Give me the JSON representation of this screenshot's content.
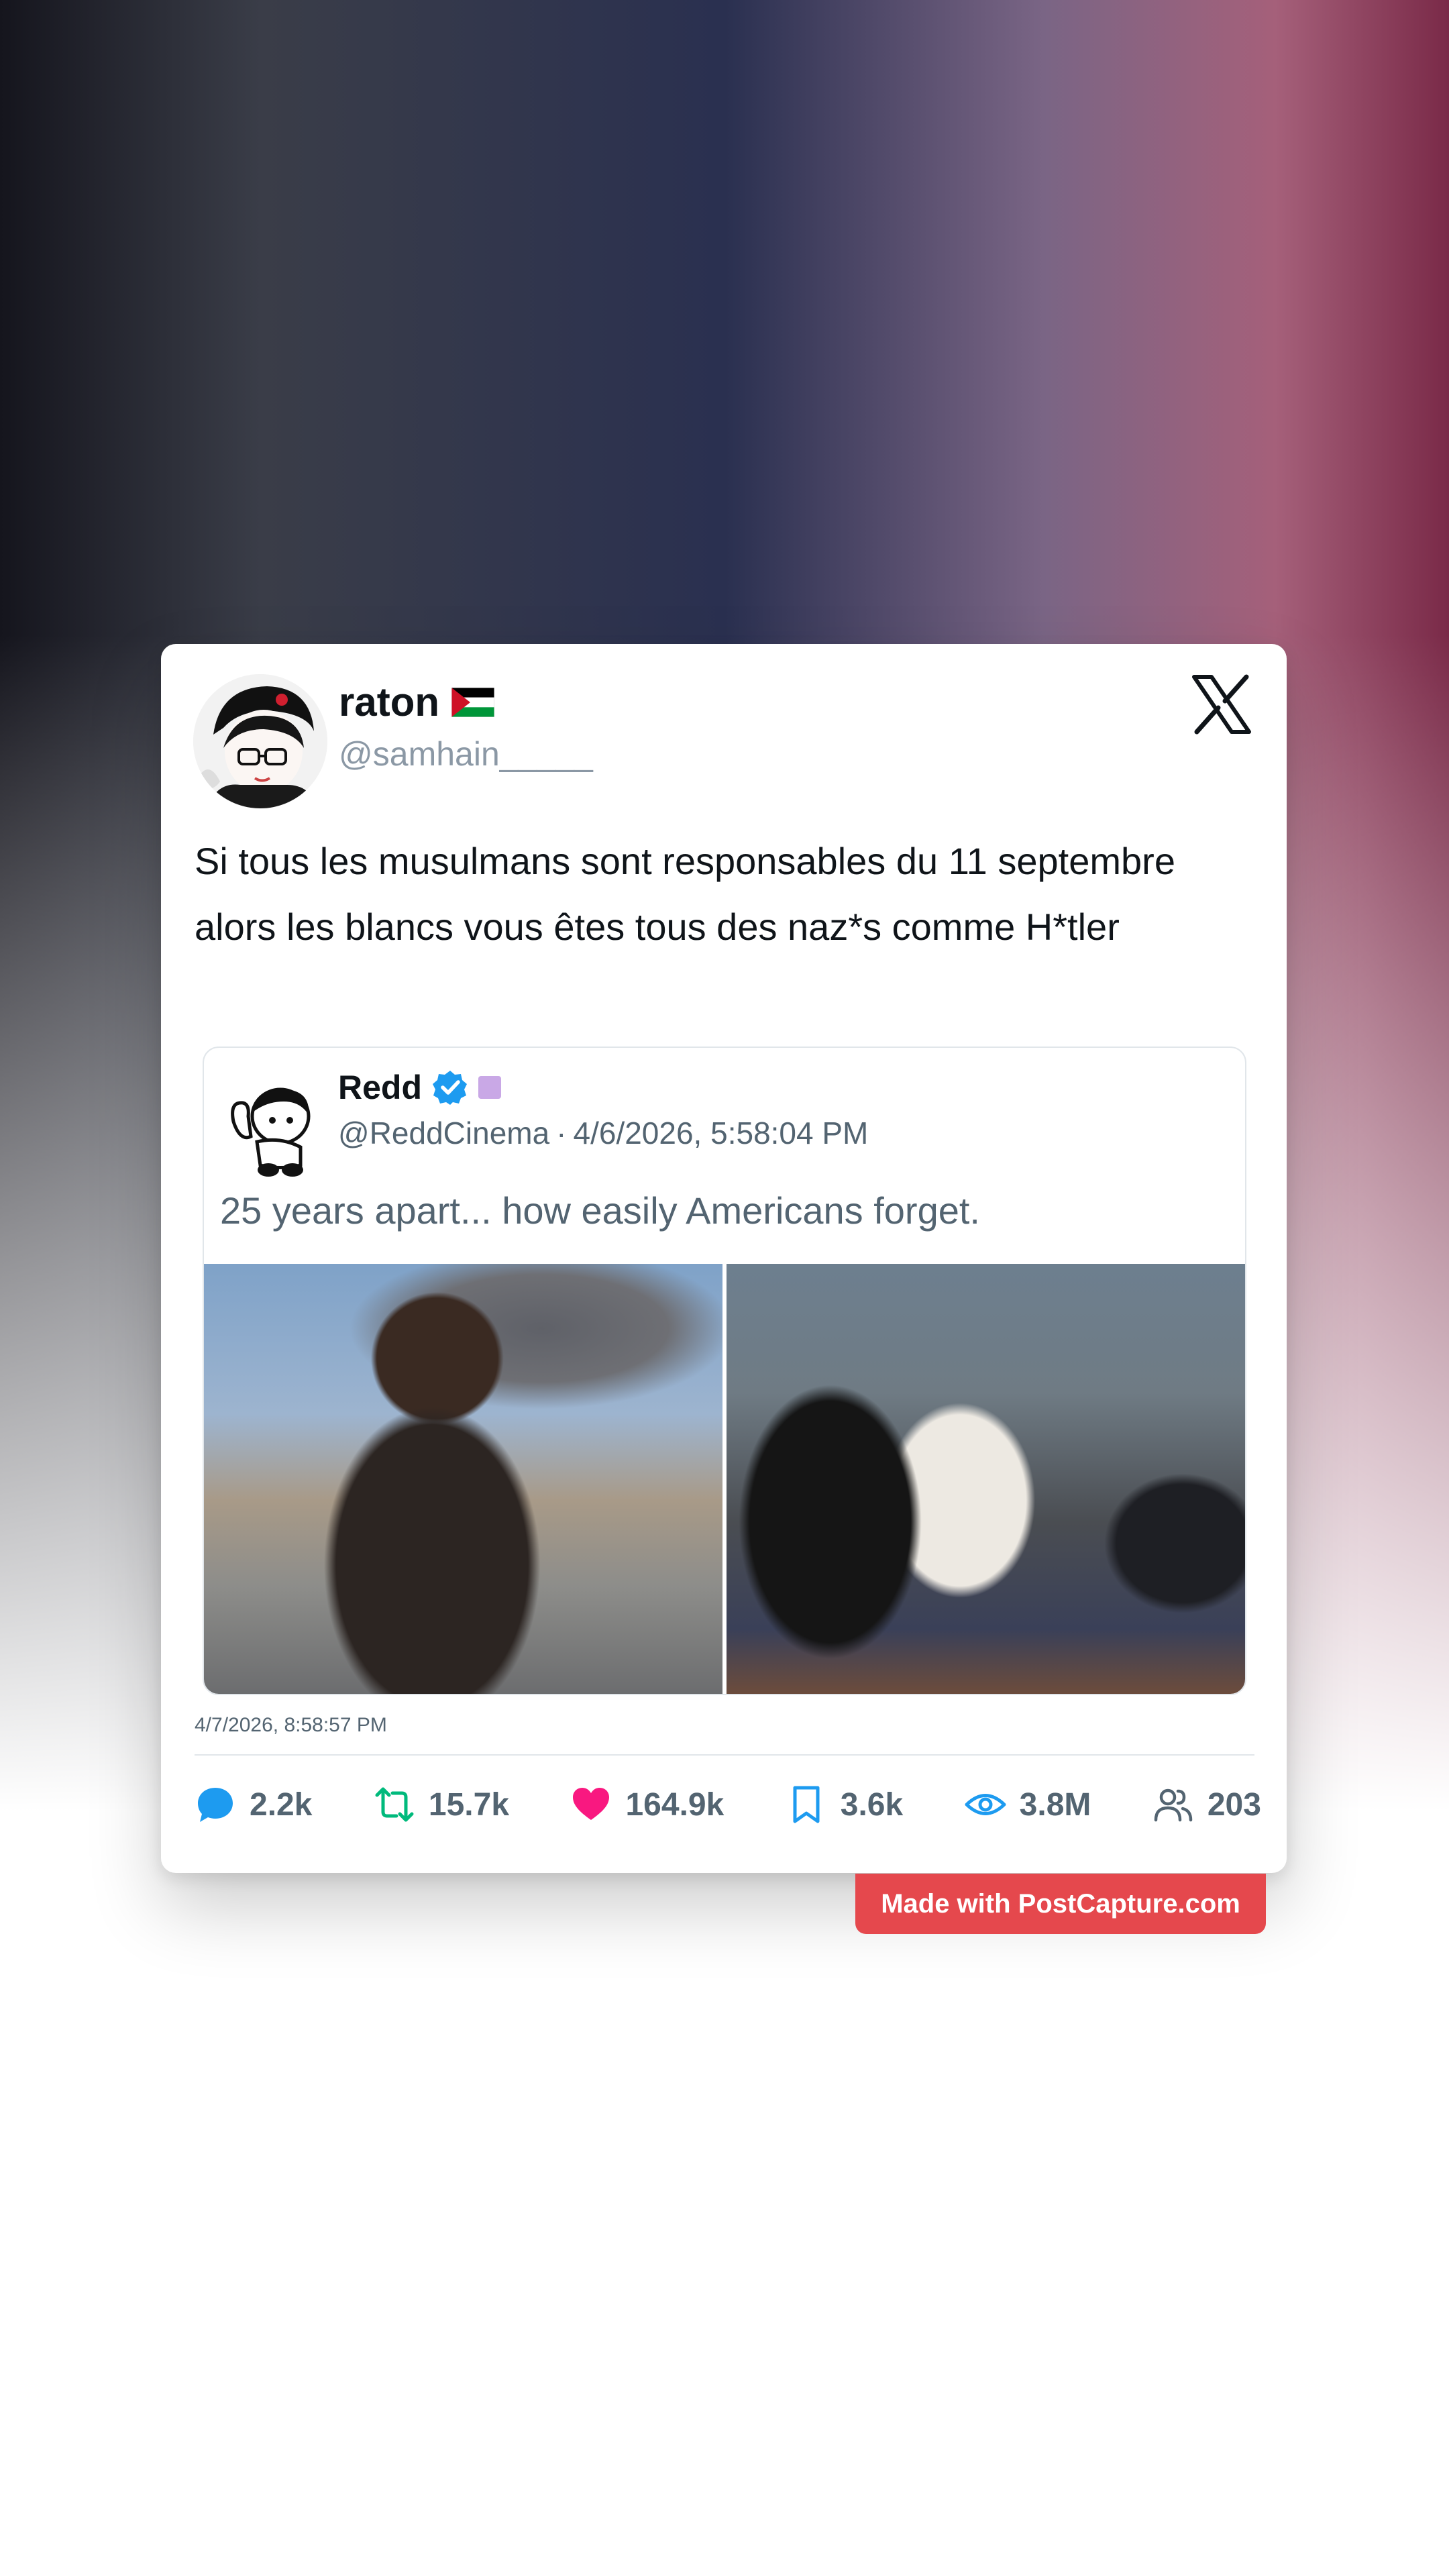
{
  "colors": {
    "brand_red": "#e5484d",
    "reply_blue": "#1d9bf0",
    "repost_green": "#00ba7c",
    "like_pink": "#f91880",
    "text_muted": "#536471"
  },
  "tweet": {
    "display_name": "raton",
    "flag_icon": "palestine-flag-icon",
    "handle": "@samhain_____",
    "platform_icon": "x-logo-icon",
    "text": "Si tous les musulmans sont responsables du 11 septembre alors les blancs vous êtes tous des naz*s comme H*tler",
    "timestamp": "4/7/2026, 8:58:57 PM"
  },
  "quoted": {
    "display_name": "Redd",
    "verified_icon": "verified-badge-icon",
    "handle": "@ReddCinema",
    "separator": "·",
    "datetime": "4/6/2026, 5:58:04 PM",
    "text": "25 years apart... how easily Americans forget.",
    "media": [
      {
        "name": "crying-woman-photo"
      },
      {
        "name": "group-sitting-photo"
      }
    ]
  },
  "stats": {
    "replies": {
      "icon": "reply-icon",
      "value": "2.2k"
    },
    "reposts": {
      "icon": "repost-icon",
      "value": "15.7k"
    },
    "likes": {
      "icon": "heart-icon",
      "value": "164.9k"
    },
    "bookmarks": {
      "icon": "bookmark-icon",
      "value": "3.6k"
    },
    "views": {
      "icon": "eye-icon",
      "value": "3.8M"
    },
    "quotes": {
      "icon": "users-icon",
      "value": "203"
    }
  },
  "watermark": {
    "label": "Made with PostCapture.com"
  }
}
